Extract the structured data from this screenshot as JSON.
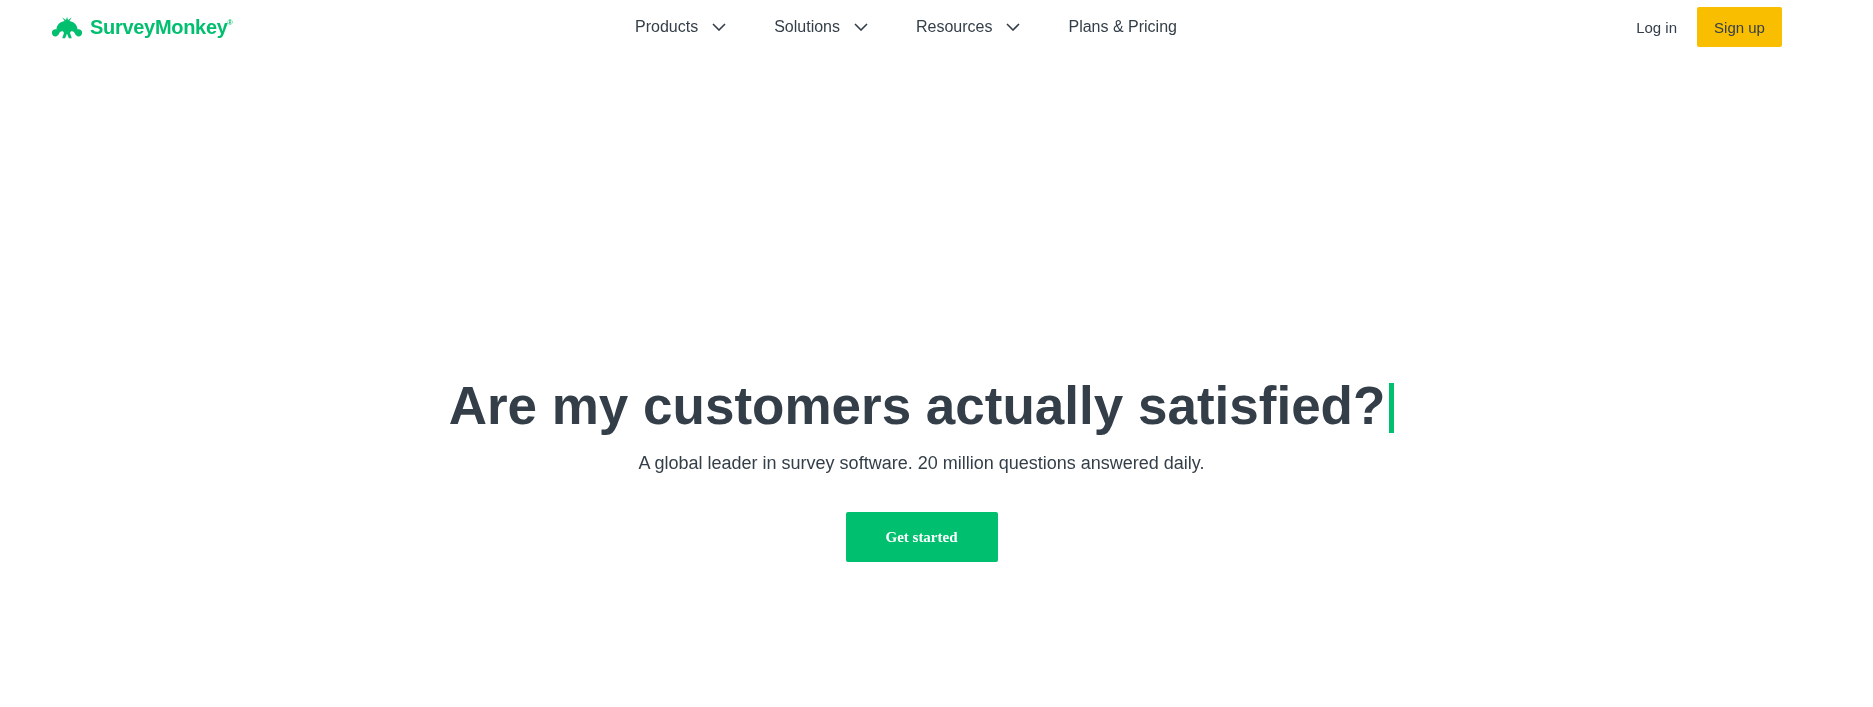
{
  "header": {
    "logo": {
      "text": "SurveyMonkey$^{®}$"
    },
    "nav": [
      {
        "label": "Products",
        "kind": "dropdown"
      },
      {
        "label": "Solutions",
        "kind": "dropdown"
      },
      {
        "label": "Resources",
        "kind": "dropdown"
      },
      {
        "label": "Plans & Pricing",
        "kind": "link"
      }
    ],
    "login": "Log in",
    "signup": "Sign up"
  },
  "hero": {
    "headline": "Are my customers actually satisfied?",
    "subtitle": "A global leader in survey software. 20 million questions answered daily.",
    "cta": "Get started"
  }
}
